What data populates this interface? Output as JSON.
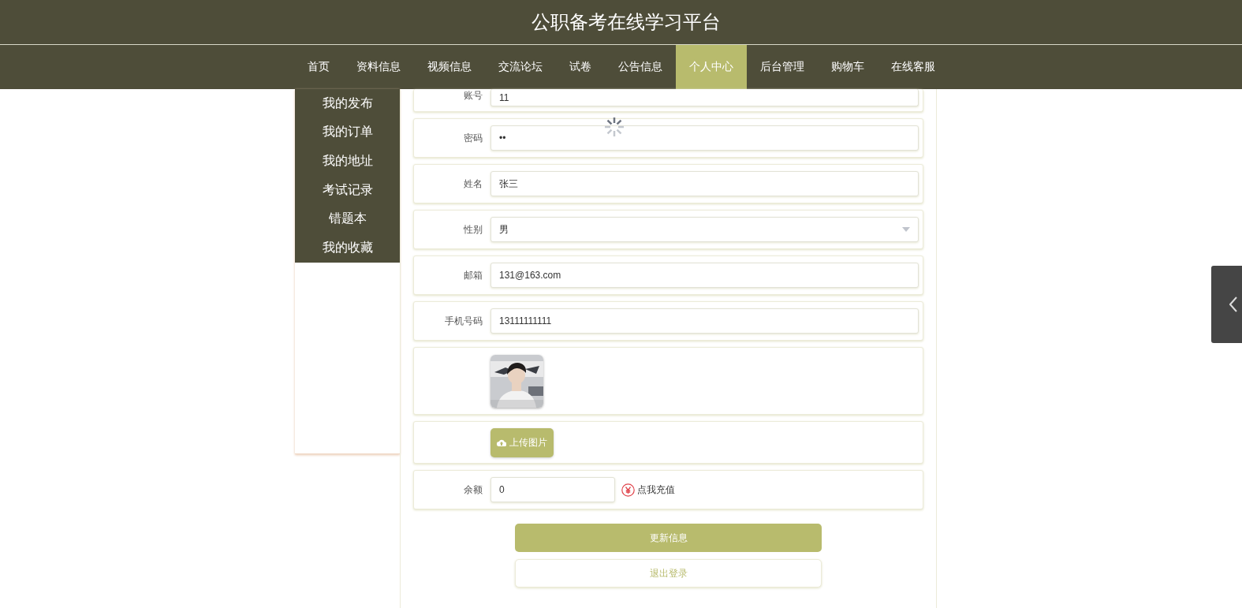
{
  "header": {
    "title": "公职备考在线学习平台"
  },
  "nav": [
    {
      "label": "首页",
      "selected": false
    },
    {
      "label": "资料信息",
      "selected": false
    },
    {
      "label": "视频信息",
      "selected": false
    },
    {
      "label": "交流论坛",
      "selected": false
    },
    {
      "label": "试卷",
      "selected": false
    },
    {
      "label": "公告信息",
      "selected": false
    },
    {
      "label": "个人中心",
      "selected": true
    },
    {
      "label": "后台管理",
      "selected": false
    },
    {
      "label": "购物车",
      "selected": false
    },
    {
      "label": "在线客服",
      "selected": false
    }
  ],
  "sidebar": {
    "items": [
      {
        "label": "我的发布",
        "selected": false
      },
      {
        "label": "我的订单",
        "selected": false
      },
      {
        "label": "我的地址",
        "selected": false
      },
      {
        "label": "考试记录",
        "selected": false
      },
      {
        "label": "错题本",
        "selected": false
      },
      {
        "label": "我的收藏",
        "selected": false
      }
    ]
  },
  "form": {
    "loading": true,
    "fields": [
      {
        "kind": "text",
        "label": "账号",
        "value": "11"
      },
      {
        "kind": "text",
        "label": "密码",
        "value": "••"
      },
      {
        "kind": "text",
        "label": "姓名",
        "value": "张三"
      },
      {
        "kind": "select",
        "label": "性别",
        "value": "男"
      },
      {
        "kind": "text",
        "label": "邮箱",
        "value": "131@163.com"
      },
      {
        "kind": "text",
        "label": "手机号码",
        "value": "13111111111"
      },
      {
        "kind": "picture"
      },
      {
        "kind": "upload",
        "button": "上传图片"
      },
      {
        "kind": "balance",
        "label": "余额",
        "value": "0",
        "link": "点我充值"
      }
    ],
    "buttons": [
      {
        "kind": "primary",
        "label": "更新信息"
      },
      {
        "kind": "outline",
        "label": "退出登录"
      }
    ]
  }
}
